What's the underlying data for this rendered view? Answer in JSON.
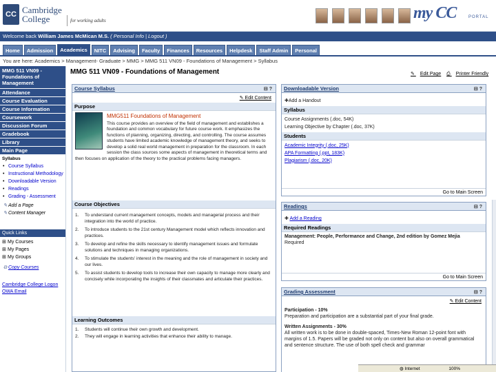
{
  "header": {
    "logo_text": "CC",
    "logo_name": "Cambridge College",
    "tagline": "for working adults",
    "portal_logo": "my CC",
    "portal_label": "PORTAL"
  },
  "welcome": {
    "prefix": "Welcome back",
    "user": "William James McMican M.S.",
    "links": "( Personal Info | Logout )"
  },
  "tabs": [
    {
      "label": "Home"
    },
    {
      "label": "Admission"
    },
    {
      "label": "Academics"
    },
    {
      "label": "NITC"
    },
    {
      "label": "Advising"
    },
    {
      "label": "Faculty"
    },
    {
      "label": "Finances"
    },
    {
      "label": "Resources"
    },
    {
      "label": "Helpdesk"
    },
    {
      "label": "Staff Admin"
    },
    {
      "label": "Personal"
    }
  ],
  "breadcrumb": "You are here: Academics > Management- Graduate > MMG > MMG 511 VN09 - Foundations of Management > Syllabus",
  "sidebar": {
    "course_title": "MMG 511 VN09 - Foundations of Management",
    "nav": [
      "Attendance",
      "Course Evaluation",
      "Course Information",
      "Coursework",
      "Discussion Forum",
      "Gradebook",
      "Library",
      "Main Page"
    ],
    "syllabus_label": "Syllabus",
    "syllabus_items": [
      "Course Syllabus",
      "Instructional Methodology",
      "Downloadable Version",
      "Readings",
      "Grading - Assessment"
    ],
    "add_page": "Add a Page",
    "content_manager": "Content Manager",
    "quick_links": "Quick Links",
    "quick_items": [
      "My Courses",
      "My Pages",
      "My Groups"
    ],
    "copy_courses": "Copy Courses",
    "footer_links": "Cambridge College Logon OWA Email"
  },
  "main": {
    "title": "MMG 511 VN09 - Foundations of Management",
    "edit_page": "Edit Page",
    "printer_friendly": "Printer Friendly"
  },
  "syllabus_panel": {
    "title": "Course Syllabus",
    "edit": "Edit Content",
    "purpose_label": "Purpose",
    "course_link": "MMG511 Foundations of Management",
    "purpose_text": "This course provides an overview of the field of management and establishes a foundation and common vocabulary for future course work. It emphasizes the functions of planning, organizing, directing, and controlling. The course assumes students have limited academic knowledge of management theory, and seeks to develop a solid real world management in preparation for the classroom. In each session the class sources some aspects of management in theoretical terms and then focuses on application of the theory to the practical problems facing managers.",
    "objectives_label": "Course Objectives",
    "objectives": [
      "To understand current management concepts, models and managerial process and their integration into the world of practice.",
      "To introduce students to the 21st century Management model which reflects innovation and practices.",
      "To develop and refine the skills necessary to identify management issues and formulate solutions and techniques in managing organizations.",
      "To stimulate the students' interest in the meaning and the role of management in society and our lives.",
      "To assist students to develop tools to increase their own capacity to manage more clearly and concisely while incorporating the insights of their classmates and articulate their practices."
    ],
    "outcomes_label": "Learning Outcomes",
    "outcomes": [
      "Students will continue their own growth and development.",
      "They will engage in learning activities that enhance their ability to manage."
    ]
  },
  "download_panel": {
    "title": "Downloadable Version",
    "add_handout": "Add a Handout",
    "syllabus_label": "Syllabus",
    "syllabus_files": [
      "Course Assignments (.doc, 54K)",
      "Learning Objective by Chapter (.doc, 37K)"
    ],
    "students_label": "Students",
    "student_files": [
      "Academic Integrity (.doc, 25K)",
      "APA Formatting (.ppt, 183K)",
      "Plagiarism (.doc, 20K)"
    ],
    "go_main": "Go to Main Screen"
  },
  "readings_panel": {
    "title": "Readings",
    "add_reading": "Add a Reading",
    "required_label": "Required Readings",
    "book_title": "Management: People, Performance and Change, 2nd edition by Gomez Mejia",
    "book_author": "Mejia",
    "book_status": "Required",
    "go_main": "Go to Main Screen"
  },
  "grading_panel": {
    "title": "Grading   Assessment",
    "edit": "Edit Content",
    "participation_label": "Participation - 10%",
    "participation_text": "Preparation and participation are a substantial part of your final grade.",
    "written_label": "Written Assignments - 30%",
    "written_text": "All written work is to be done in double-spaced, Times-New Roman 12-point font with margins of 1.5. Papers will be graded not only on content but also on overall grammatical and sentence structure. The use of both spell check and grammar"
  },
  "status": {
    "zone": "Internet",
    "zoom": "100%"
  },
  "colors": {
    "brand": "#2e4f88",
    "tab": "#5f7fb0",
    "panel_header": "#dde6f2"
  }
}
